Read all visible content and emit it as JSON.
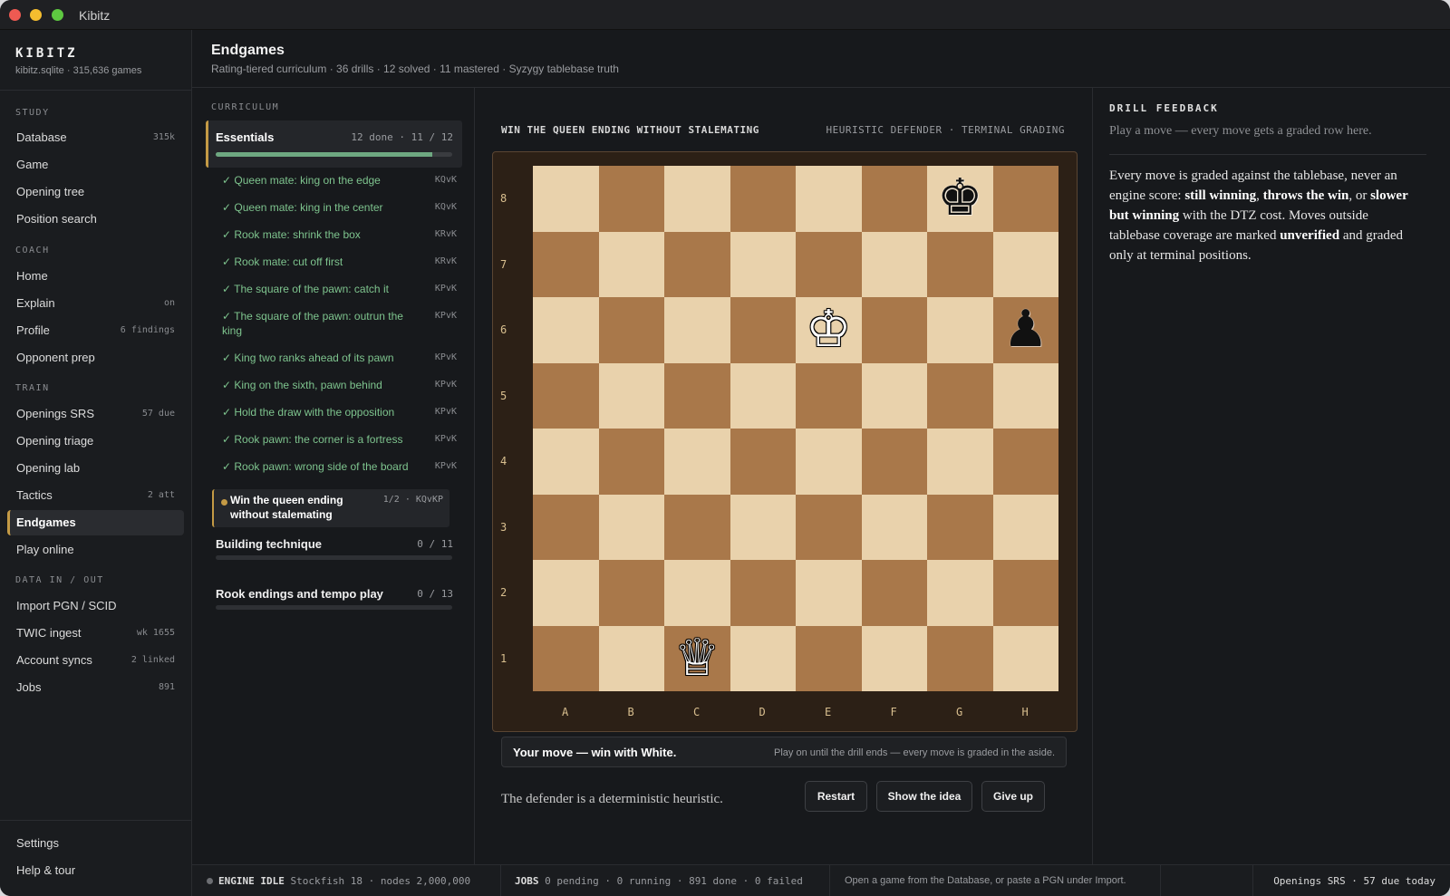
{
  "window": {
    "title": "Kibitz"
  },
  "brand": {
    "name": "KIBITZ",
    "sub": "kibitz.sqlite · 315,636 games"
  },
  "nav": {
    "sections": {
      "study": "STUDY",
      "coach": "COACH",
      "train": "TRAIN",
      "data": "DATA IN / OUT"
    },
    "items": [
      {
        "label": "Database",
        "badge": "315k"
      },
      {
        "label": "Game",
        "badge": ""
      },
      {
        "label": "Opening tree",
        "badge": ""
      },
      {
        "label": "Position search",
        "badge": ""
      },
      {
        "label": "Home",
        "badge": ""
      },
      {
        "label": "Explain",
        "badge": "on"
      },
      {
        "label": "Profile",
        "badge": "6 findings"
      },
      {
        "label": "Opponent prep",
        "badge": ""
      },
      {
        "label": "Openings SRS",
        "badge": "57 due"
      },
      {
        "label": "Opening triage",
        "badge": ""
      },
      {
        "label": "Opening lab",
        "badge": ""
      },
      {
        "label": "Tactics",
        "badge": "2 att"
      },
      {
        "label": "Endgames",
        "badge": ""
      },
      {
        "label": "Play online",
        "badge": ""
      },
      {
        "label": "Import PGN / SCID",
        "badge": ""
      },
      {
        "label": "TWIC ingest",
        "badge": "wk 1655"
      },
      {
        "label": "Account syncs",
        "badge": "2 linked"
      },
      {
        "label": "Jobs",
        "badge": "891"
      }
    ],
    "footer": [
      {
        "label": "Settings"
      },
      {
        "label": "Help & tour"
      }
    ]
  },
  "header": {
    "title": "Endgames",
    "subtitle": "Rating-tiered curriculum · 36 drills · 12 solved · 11 mastered · Syzygy tablebase truth"
  },
  "curriculum": {
    "heading": "CURRICULUM",
    "groups": [
      {
        "name": "Essentials",
        "stat": "12 done · 11 / 12",
        "progress": 0.917
      },
      {
        "name": "Building technique",
        "stat": "0 / 11",
        "progress": 0
      },
      {
        "name": "Rook endings and tempo play",
        "stat": "0 / 13",
        "progress": 0
      }
    ],
    "drills": [
      {
        "name": "✓ Queen mate: king on the edge",
        "tag": "KQvK"
      },
      {
        "name": "✓ Queen mate: king in the center",
        "tag": "KQvK"
      },
      {
        "name": "✓ Rook mate: shrink the box",
        "tag": "KRvK"
      },
      {
        "name": "✓ Rook mate: cut off first",
        "tag": "KRvK"
      },
      {
        "name": "✓ The square of the pawn: catch it",
        "tag": "KPvK"
      },
      {
        "name": "✓ The square of the pawn: outrun the king",
        "tag": "KPvK"
      },
      {
        "name": "✓ King two ranks ahead of its pawn",
        "tag": "KPvK"
      },
      {
        "name": "✓ King on the sixth, pawn behind",
        "tag": "KPvK"
      },
      {
        "name": "✓ Hold the draw with the opposition",
        "tag": "KPvK"
      },
      {
        "name": "✓ Rook pawn: the corner is a fortress",
        "tag": "KPvK"
      },
      {
        "name": "✓ Rook pawn: wrong side of the board",
        "tag": "KPvK"
      }
    ],
    "current": {
      "name": "Win the queen ending without stalemating",
      "tag": "1/2 · KQvKP"
    }
  },
  "board": {
    "drill_title": "WIN THE QUEEN ENDING WITHOUT STALEMATING",
    "mode": "HEURISTIC DEFENDER · TERMINAL GRADING",
    "files": [
      "A",
      "B",
      "C",
      "D",
      "E",
      "F",
      "G",
      "H"
    ],
    "ranks": [
      "8",
      "7",
      "6",
      "5",
      "4",
      "3",
      "2",
      "1"
    ],
    "pieces": [
      {
        "square": "g8",
        "glyph": "♚",
        "color": "black",
        "name": "black-king"
      },
      {
        "square": "e6",
        "glyph": "♔",
        "color": "white",
        "name": "white-king"
      },
      {
        "square": "h6",
        "glyph": "♟",
        "color": "black",
        "name": "black-pawn"
      },
      {
        "square": "c1",
        "glyph": "♕",
        "color": "white",
        "name": "white-queen"
      }
    ],
    "colors": {
      "light": "#e9d2ac",
      "dark": "#a9784a"
    },
    "status_main": "Your move — win with White.",
    "status_hint": "Play on until the drill ends — every move is graded in the aside.",
    "defender_note": "The defender is a deterministic heuristic.",
    "buttons": {
      "restart": "Restart",
      "idea": "Show the idea",
      "giveup": "Give up"
    }
  },
  "feedback": {
    "heading": "DRILL FEEDBACK",
    "hint": "Play a move — every move gets a graded row here.",
    "body": {
      "p1": "Every move is graded against the tablebase, never an engine score: ",
      "b1": "still winning",
      "p2": ", ",
      "b2": "throws the win",
      "p3": ", or ",
      "b3": "slower but winning",
      "p4": " with the DTZ cost. Moves outside tablebase coverage are marked ",
      "b4": "unverified",
      "p5": " and graded only at terminal positions."
    }
  },
  "statusbar": {
    "engine_label": "ENGINE IDLE",
    "engine_detail": "Stockfish 18 · nodes 2,000,000",
    "jobs_label": "JOBS",
    "jobs_detail": "0 pending · 0 running · 891 done · 0 failed",
    "message": "Open a game from the Database, or paste a PGN under Import.",
    "right": "Openings SRS · 57 due today"
  },
  "accent": "#c49a45",
  "success": "#7ec48e"
}
